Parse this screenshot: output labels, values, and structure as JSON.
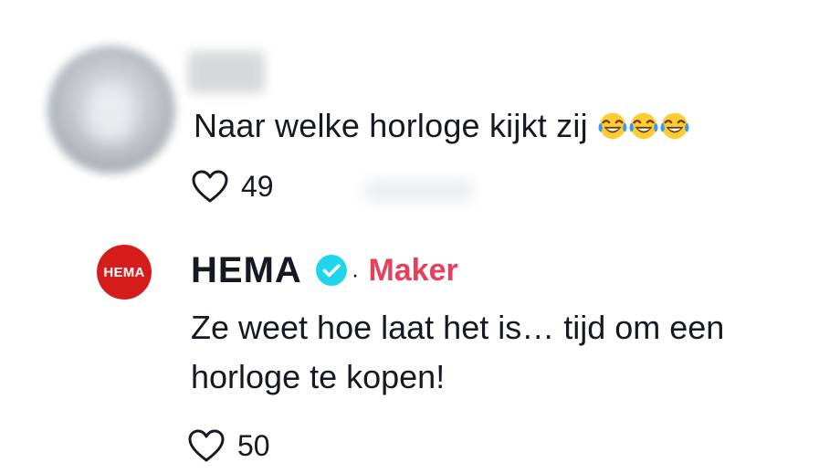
{
  "comment": {
    "text": "Naar welke horloge kijkt zij",
    "emoji": [
      "face-with-tears-of-joy",
      "face-with-tears-of-joy",
      "face-with-tears-of-joy"
    ],
    "likes": "49"
  },
  "reply": {
    "avatar_text": "HEMA",
    "author": "HEMA",
    "separator": "·",
    "badge": "Maker",
    "text": "Ze weet hoe laat het is… tijd om een horloge te kopen!",
    "likes": "50"
  },
  "colors": {
    "text": "#161823",
    "badge": "#e83f5b",
    "verified": "#20d5ec",
    "brand_red": "#d71d1b"
  },
  "icons": {
    "like": "heart-outline-icon",
    "verified": "verified-check-icon",
    "emoji": "laughing-crying-emoji-icon"
  }
}
